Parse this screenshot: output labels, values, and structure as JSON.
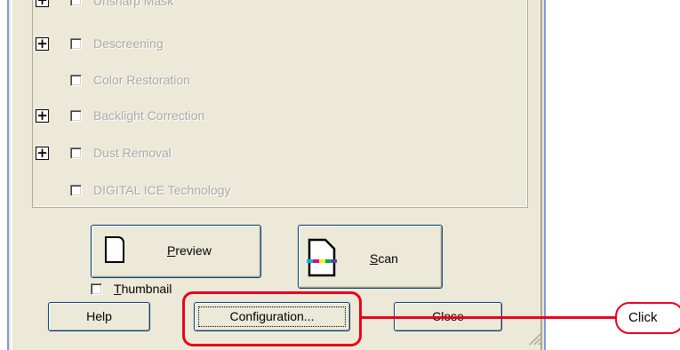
{
  "options": [
    {
      "label": "Unsharp Mask",
      "expandable": true,
      "checked": false,
      "enabled": false
    },
    {
      "label": "Descreening",
      "expandable": true,
      "checked": false,
      "enabled": false
    },
    {
      "label": "Color Restoration",
      "expandable": false,
      "checked": false,
      "enabled": false
    },
    {
      "label": "Backlight Correction",
      "expandable": true,
      "checked": false,
      "enabled": false
    },
    {
      "label": "Dust Removal",
      "expandable": true,
      "checked": false,
      "enabled": false
    },
    {
      "label": "DIGITAL ICE Technology",
      "expandable": false,
      "checked": false,
      "enabled": false
    }
  ],
  "expander_glyph": "+",
  "buttons": {
    "preview": "Preview",
    "scan": "Scan",
    "help": "Help",
    "configuration": "Configuration...",
    "close": "Close"
  },
  "thumbnail": {
    "label": "Thumbnail",
    "checked": false
  },
  "annotation": {
    "text": "Click",
    "color": "#e8001c"
  },
  "icons": [
    "plus-expander-icon",
    "preview-document-icon",
    "scan-document-icon",
    "resize-grip-icon"
  ]
}
